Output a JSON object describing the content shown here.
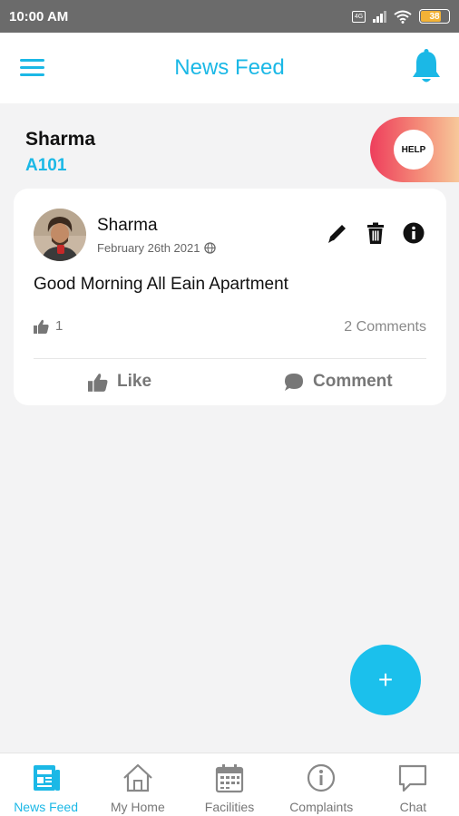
{
  "status_bar": {
    "time": "10:00 AM",
    "battery": "38"
  },
  "app_bar": {
    "title": "News Feed"
  },
  "user": {
    "name": "Sharma",
    "unit": "A101",
    "help_label": "HELP"
  },
  "post": {
    "author": "Sharma",
    "date": "February 26th 2021",
    "text": "Good Morning All Eain Apartment",
    "likes": "1",
    "comments": "2 Comments",
    "like_label": "Like",
    "comment_label": "Comment"
  },
  "fab": {
    "label": "+"
  },
  "nav": {
    "items": [
      {
        "label": "News Feed",
        "icon": "newspaper-icon",
        "active": true
      },
      {
        "label": "My Home",
        "icon": "home-icon"
      },
      {
        "label": "Facilities",
        "icon": "calendar-icon"
      },
      {
        "label": "Complaints",
        "icon": "info-circle-icon"
      },
      {
        "label": "Chat",
        "icon": "chat-bubble-icon"
      }
    ]
  },
  "colors": {
    "accent": "#1bb8e6",
    "fab": "#1bc0ec",
    "status_bar": "#6b6b6b",
    "help_gradient_start": "#ee3e5c"
  }
}
